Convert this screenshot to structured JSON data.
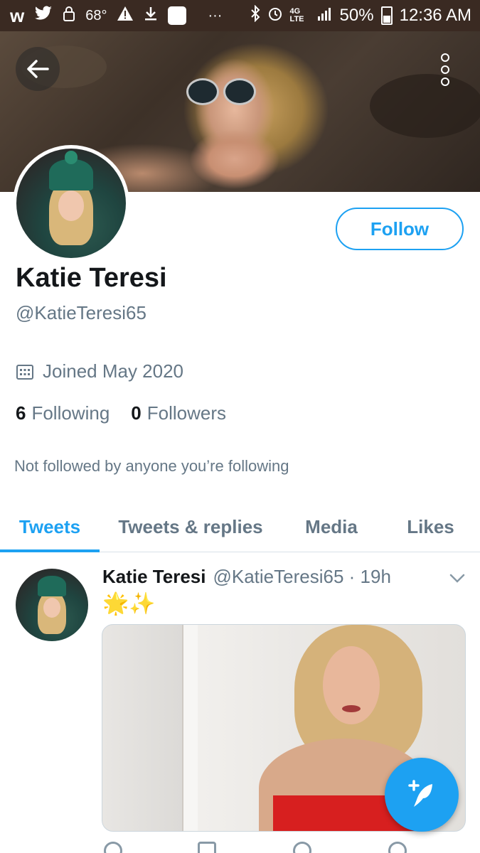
{
  "status_bar": {
    "temperature": "68°",
    "battery_percent": "50%",
    "time": "12:36 AM",
    "network": "4G LTE",
    "ellipsis": "···"
  },
  "header": {
    "back_icon": "arrow-left-icon",
    "more_icon": "vertical-dots-icon"
  },
  "profile": {
    "display_name": "Katie Teresi",
    "handle": "@KatieTeresi65",
    "joined": "Joined May 2020",
    "following_count": "6",
    "following_label": "Following",
    "followers_count": "0",
    "followers_label": "Followers",
    "not_followed_text": "Not followed by anyone you’re following",
    "follow_label": "Follow"
  },
  "tabs": [
    {
      "label": "Tweets",
      "active": true
    },
    {
      "label": "Tweets & replies",
      "active": false
    },
    {
      "label": "Media",
      "active": false
    },
    {
      "label": "Likes",
      "active": false
    }
  ],
  "tweet": {
    "name": "Katie Teresi",
    "meta": "@KatieTeresi65 · 19h",
    "text": "🌟✨"
  },
  "colors": {
    "accent": "#1da1f2",
    "secondary_text": "#657786",
    "primary_text": "#14171a"
  }
}
